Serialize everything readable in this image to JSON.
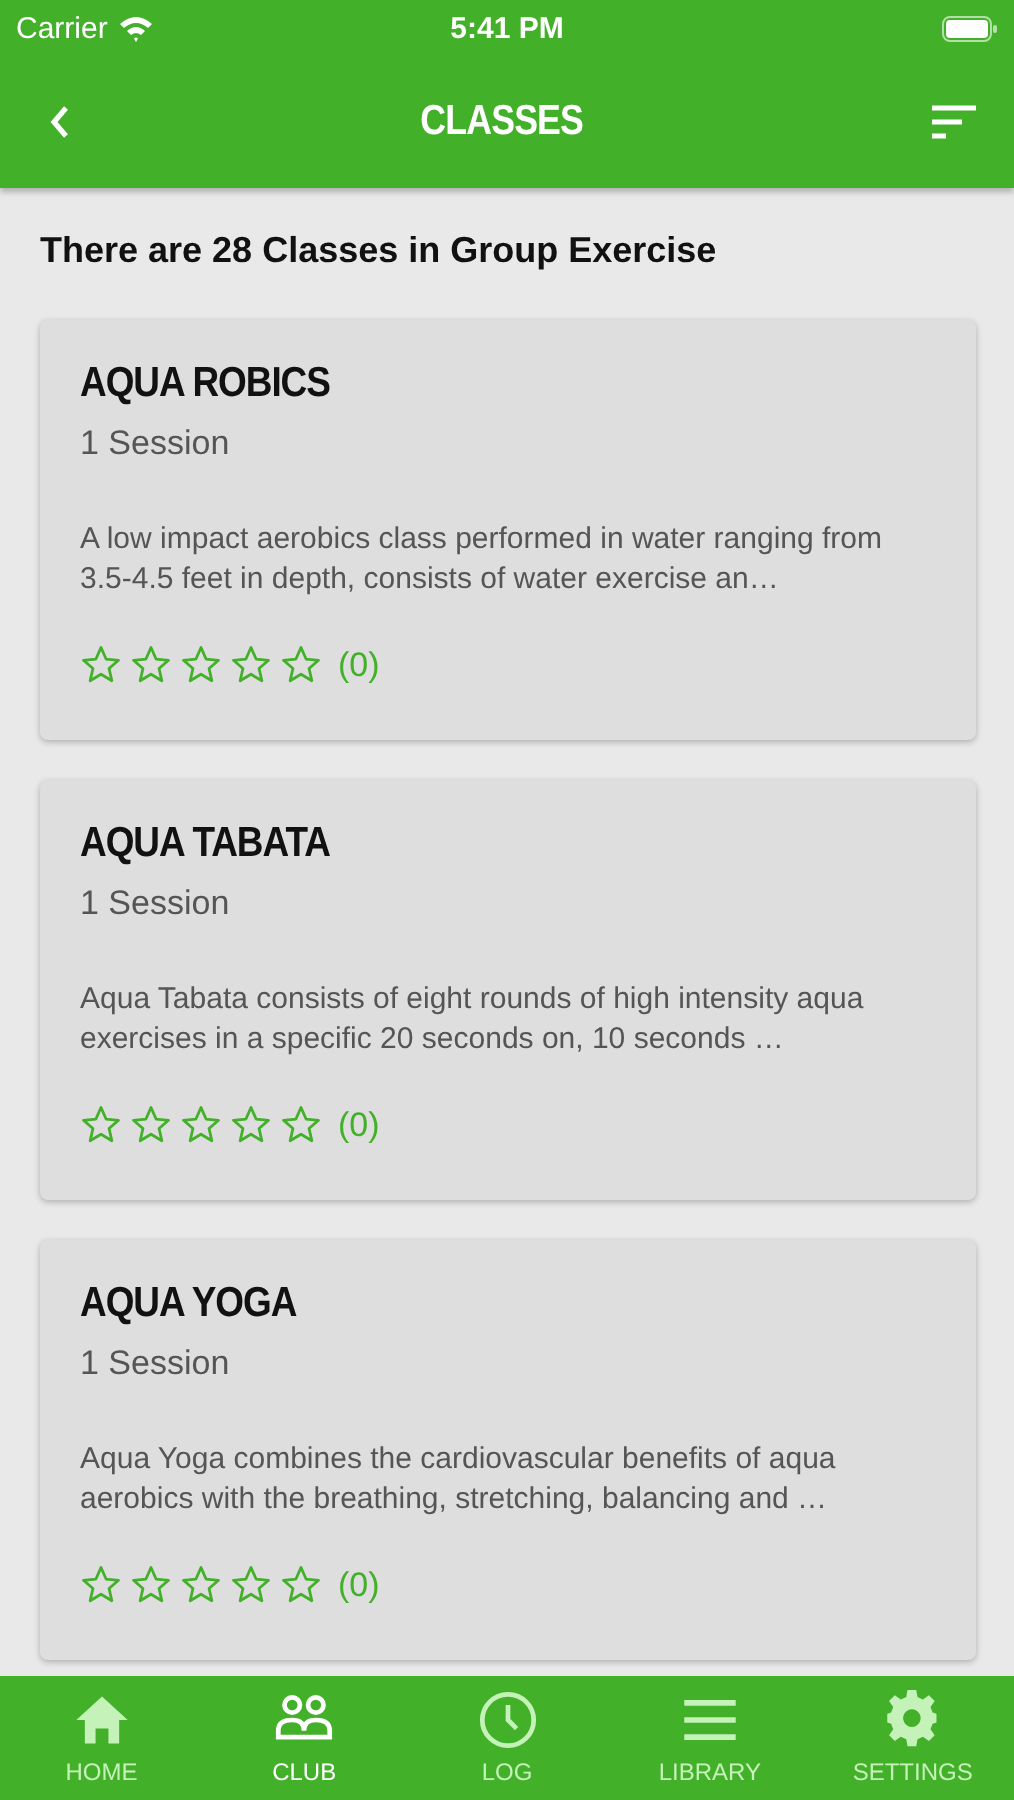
{
  "status_bar": {
    "carrier": "Carrier",
    "time": "5:41 PM"
  },
  "nav_bar": {
    "title": "CLASSES"
  },
  "heading": "There are 28 Classes in Group Exercise",
  "classes": [
    {
      "name": "AQUA ROBICS",
      "sessions": "1 Session",
      "description": "A low impact aerobics class performed in water ranging from 3.5-4.5 feet in depth, consists of water exercise an…",
      "stars": 0,
      "rating_count": "(0)"
    },
    {
      "name": "AQUA TABATA",
      "sessions": "1 Session",
      "description": "Aqua Tabata consists of eight rounds of high intensity aqua exercises in a specific 20 seconds on, 10 seconds …",
      "stars": 0,
      "rating_count": "(0)"
    },
    {
      "name": "AQUA YOGA",
      "sessions": "1 Session",
      "description": "Aqua Yoga combines the cardiovascular benefits of aqua aerobics with the breathing, stretching, balancing and …",
      "stars": 0,
      "rating_count": "(0)"
    }
  ],
  "tab_bar": [
    {
      "label": "HOME",
      "kind": "home",
      "selected": false
    },
    {
      "label": "CLUB",
      "kind": "club",
      "selected": true
    },
    {
      "label": "LOG",
      "kind": "log",
      "selected": false
    },
    {
      "label": "LIBRARY",
      "kind": "library",
      "selected": false
    },
    {
      "label": "SETTINGS",
      "kind": "settings",
      "selected": false
    }
  ]
}
